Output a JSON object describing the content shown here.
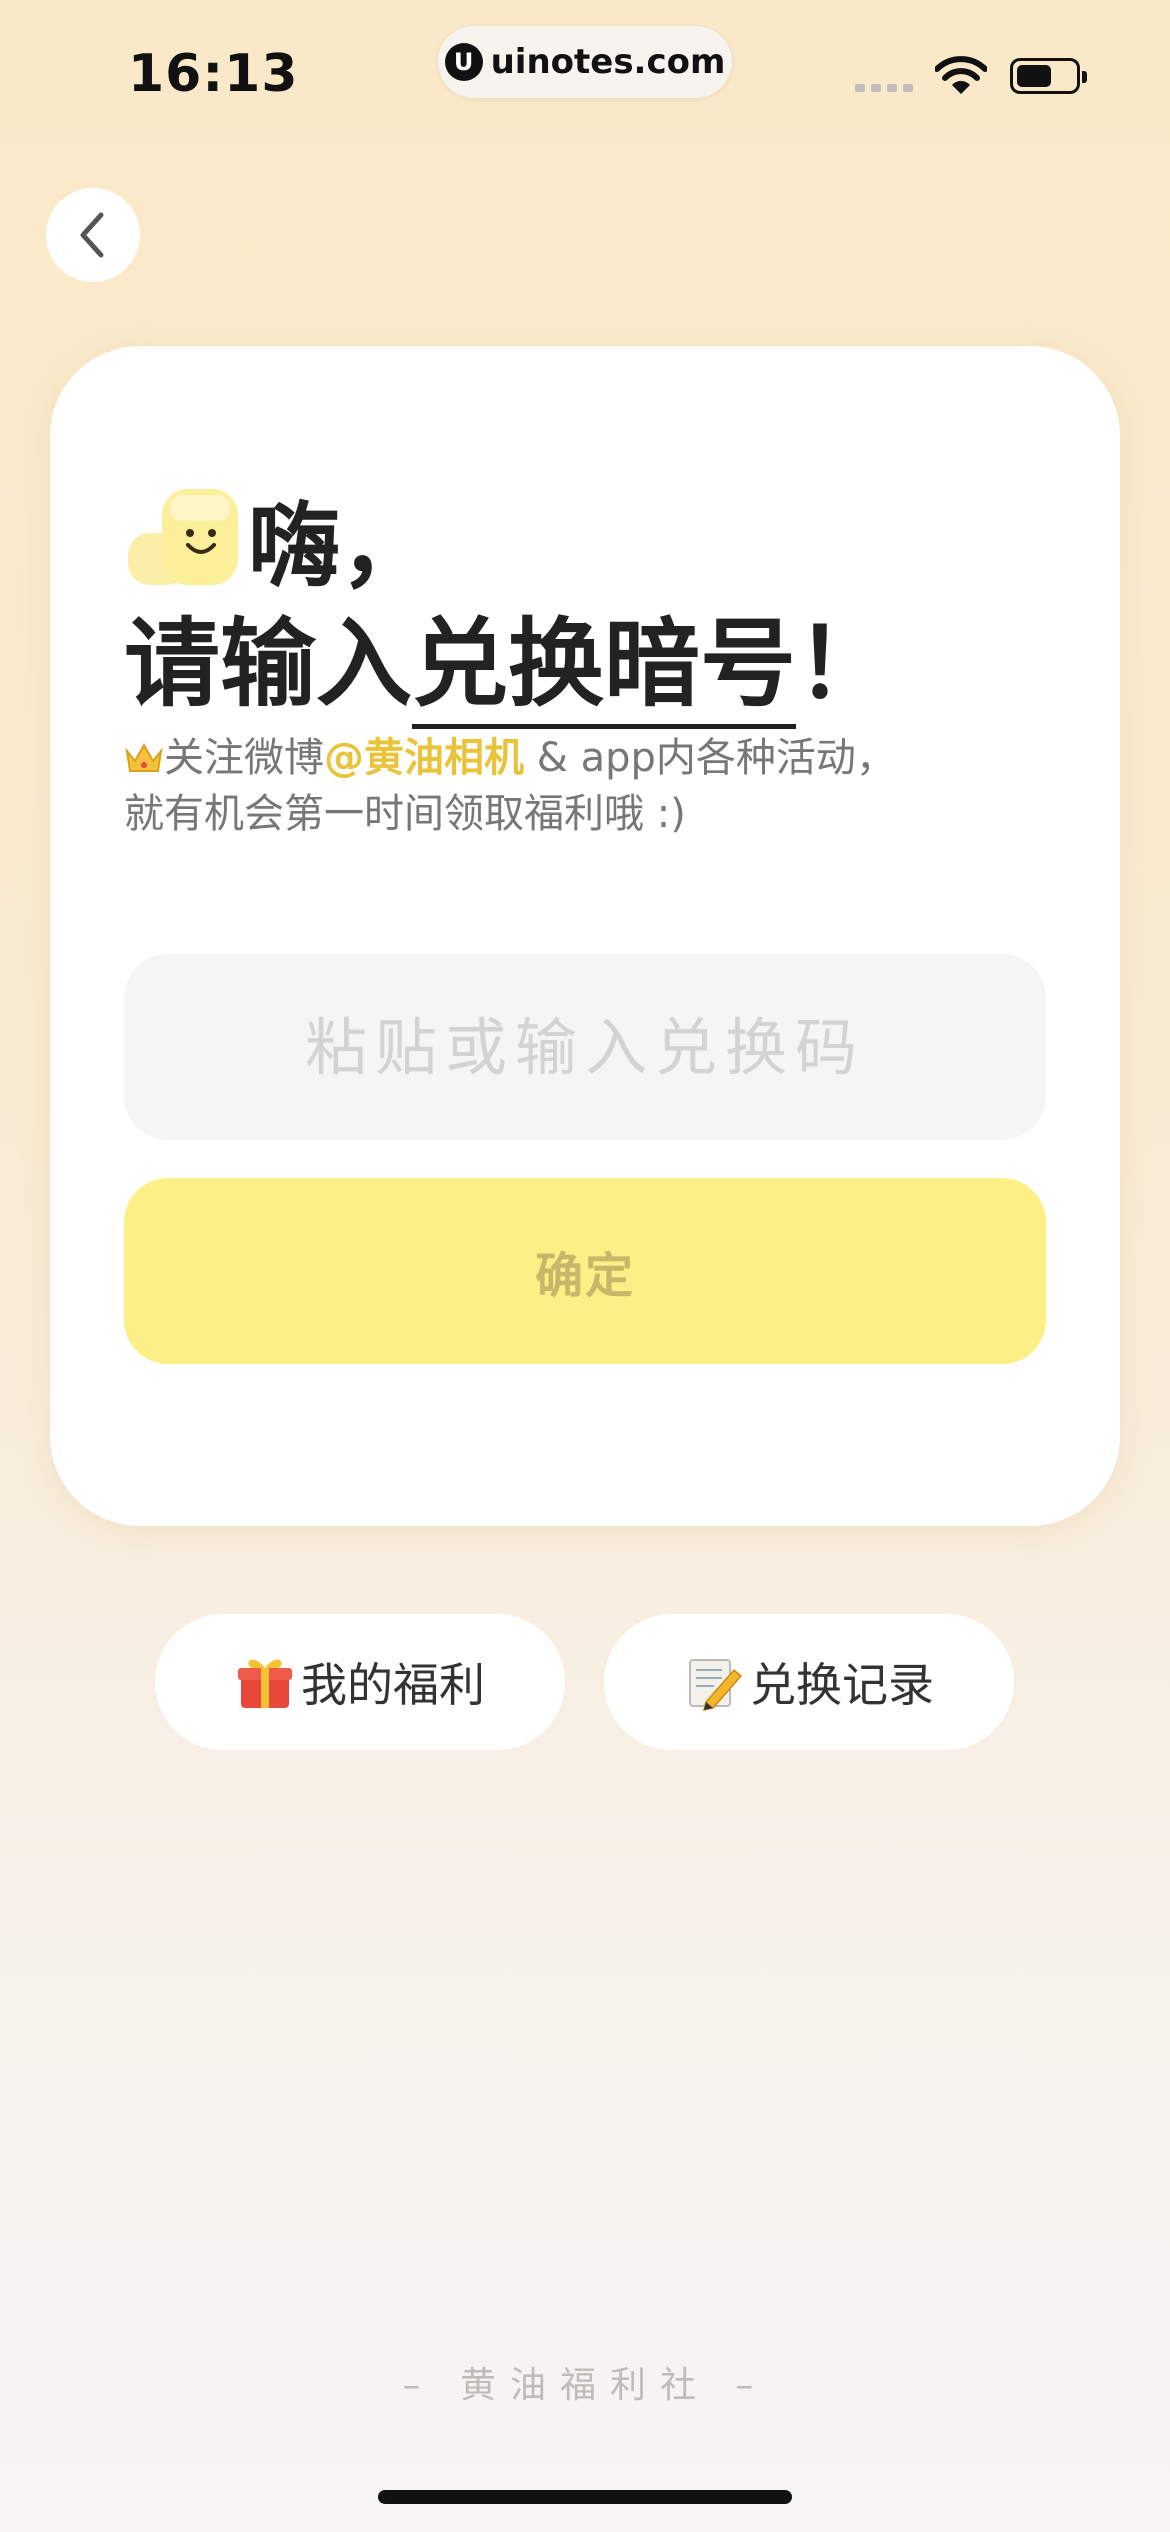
{
  "status_bar": {
    "time": "16:13",
    "url": "uinotes.com",
    "url_logo": "U"
  },
  "header": {
    "back_icon": "chevron-left-icon"
  },
  "card": {
    "hi_text": "嗨，",
    "headline_prefix": "请输入",
    "headline_emphasis": "兑换暗号",
    "headline_suffix": "！",
    "subtitle_line1_prefix": "关注微博",
    "subtitle_line1_highlight": "@黄油相机",
    "subtitle_line1_suffix": " & app内各种活动，",
    "subtitle_line2": "就有机会第一时间领取福利哦 :)",
    "input_placeholder": "粘贴或输入兑换码",
    "input_value": "",
    "confirm_label": "确定"
  },
  "actions": {
    "benefits_label": "我的福利",
    "history_label": "兑换记录"
  },
  "footer": {
    "text": "– 黄油福利社 –"
  },
  "colors": {
    "accent_yellow": "#fcef86",
    "highlight": "#e9c33a",
    "background_top": "#fae9c8"
  }
}
